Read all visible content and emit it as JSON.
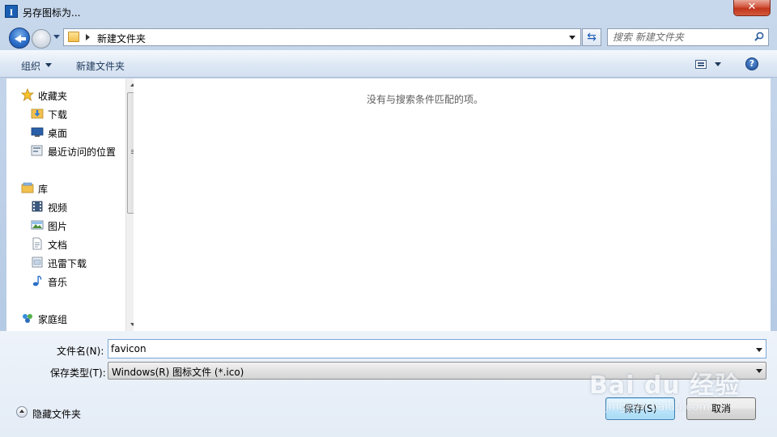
{
  "window": {
    "title": "另存图标为..."
  },
  "address": {
    "crumb": "新建文件夹"
  },
  "search": {
    "placeholder": "搜索 新建文件夹"
  },
  "toolbar": {
    "organize_label": "组织",
    "new_folder_label": "新建文件夹"
  },
  "nav": {
    "favorites": {
      "label": "收藏夹",
      "items": [
        "下载",
        "桌面",
        "最近访问的位置"
      ]
    },
    "library": {
      "label": "库",
      "items": [
        "视频",
        "图片",
        "文档",
        "迅雷下载",
        "音乐"
      ]
    },
    "homegroup": {
      "label": "家庭组"
    }
  },
  "content": {
    "empty_message": "没有与搜索条件匹配的项。"
  },
  "form": {
    "filename_label": "文件名(N):",
    "filename_value": "favicon",
    "filetype_label": "保存类型(T):",
    "filetype_value": "Windows(R) 图标文件 (*.ico)"
  },
  "footer": {
    "hide_folders_label": "隐藏文件夹",
    "save_label": "保存(S)",
    "cancel_label": "取消"
  },
  "watermark": {
    "text": "Bai du 经验",
    "url": "jingyan.baidu.com"
  },
  "colors": {
    "accent": "#1c5bb5",
    "toolbar_text": "#1e395b",
    "window_frame": "#b9cde6"
  }
}
